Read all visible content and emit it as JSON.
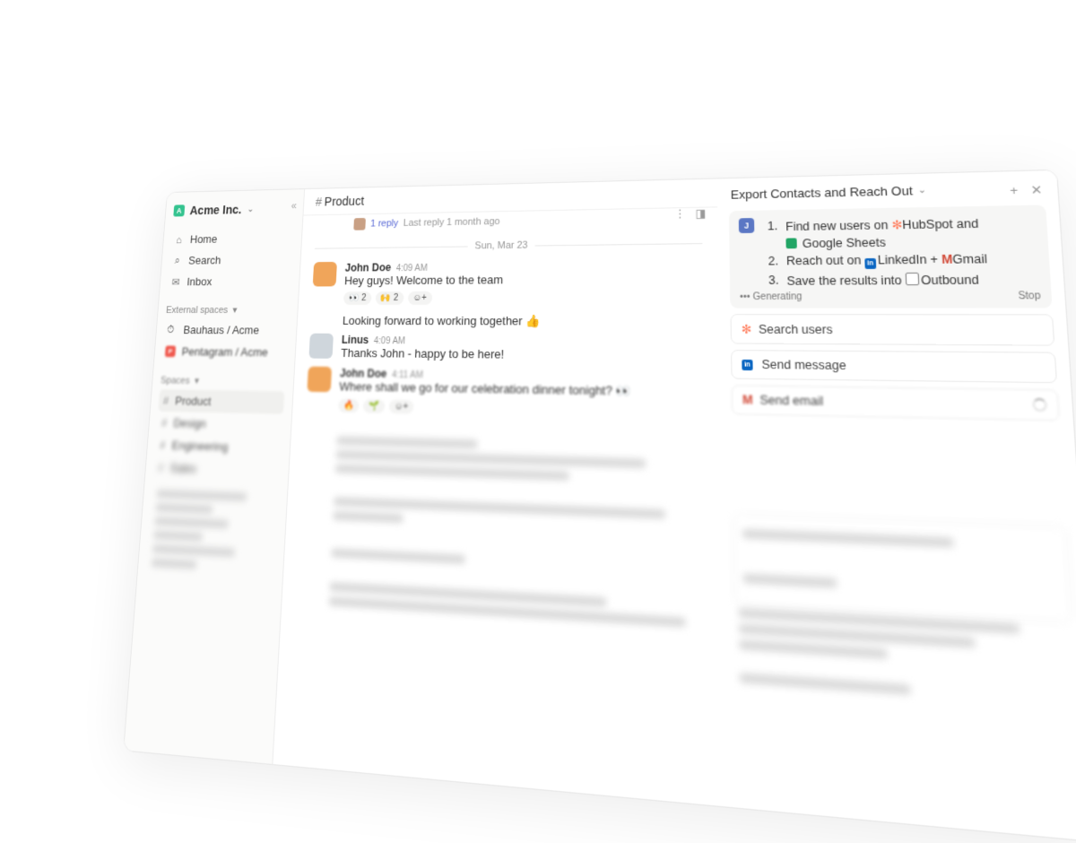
{
  "workspace": {
    "name": "Acme Inc.",
    "logo_letter": "A"
  },
  "sidebar": {
    "nav": [
      {
        "label": "Home",
        "icon": "home-icon"
      },
      {
        "label": "Search",
        "icon": "search-icon"
      },
      {
        "label": "Inbox",
        "icon": "inbox-icon"
      }
    ],
    "external_label": "External spaces",
    "external_spaces": [
      {
        "label": "Bauhaus / Acme",
        "icon": "clock-icon"
      },
      {
        "label": "Pentagram / Acme",
        "icon": "pentagram-logo",
        "badge": "P",
        "color": "#f05a4f"
      }
    ],
    "spaces_label": "Spaces",
    "channels": [
      {
        "label": "Product",
        "active": true
      },
      {
        "label": "Design"
      },
      {
        "label": "Engineering"
      },
      {
        "label": "Sales"
      }
    ]
  },
  "channel": {
    "name": "Product",
    "top_thread": {
      "reply_count": "1 reply",
      "last_reply": "Last reply 1 month ago"
    },
    "date_divider": "Sun, Mar 23",
    "messages": [
      {
        "author": "John Doe",
        "time": "4:09 AM",
        "text": "Hey guys! Welcome to the team",
        "reactions": [
          "👀 2",
          "🙌 2"
        ]
      },
      {
        "continuation": "Looking forward to working together 👍"
      },
      {
        "author": "Linus",
        "time": "4:09 AM",
        "text": "Thanks John - happy to be here!"
      },
      {
        "author": "John Doe",
        "time": "4:11 AM",
        "text": "Where shall we go for our celebration dinner tonight? 👀"
      }
    ]
  },
  "panel": {
    "title": "Export Contacts and Reach Out",
    "badge": "J",
    "steps": {
      "s1_num": "1.",
      "s1_a": "Find new users on",
      "s1_hubspot": "HubSpot and",
      "s1_sheets": "Google Sheets",
      "s2_num": "2.",
      "s2_a": "Reach out on",
      "s2_linkedin": "LinkedIn",
      "s2_plus": "+",
      "s2_gmail": "Gmail",
      "s3_num": "3.",
      "s3_a": "Save the results into",
      "s3_outbound": "Outbound"
    },
    "status": "Generating",
    "stop_label": "Stop",
    "tools": [
      {
        "label": "Search users",
        "icon": "hubspot-icon"
      },
      {
        "label": "Send message",
        "icon": "linkedin-icon"
      },
      {
        "label": "Send email",
        "icon": "gmail-icon"
      }
    ]
  },
  "colors": {
    "accent": "#5b6bd6",
    "workspace_logo": "#34c38f",
    "hubspot": "#ff7a59",
    "linkedin": "#0a66c2",
    "sheets": "#22a565"
  }
}
